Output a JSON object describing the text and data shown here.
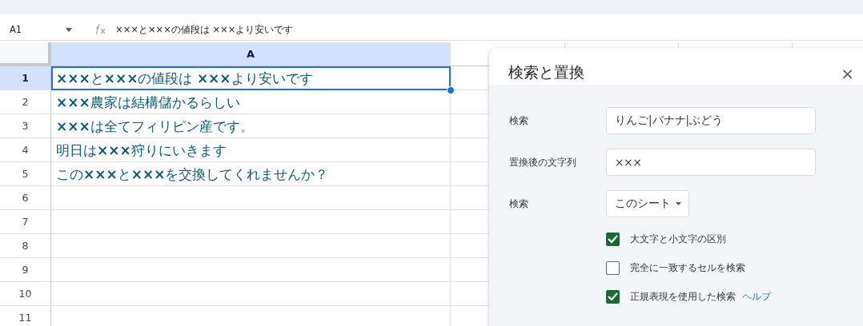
{
  "formula_bar": {
    "cell_ref": "A1",
    "formula": "×××と×××の値段は ×××より安いです"
  },
  "grid": {
    "columns": [
      {
        "label": "A",
        "selected": true
      }
    ],
    "rows": [
      {
        "number": "1",
        "selected": true,
        "cells": [
          "**×××**と**×××**の値段は **×××**より安いです"
        ]
      },
      {
        "number": "2",
        "selected": false,
        "cells": [
          "**×××**農家は結構儲かるらしい"
        ]
      },
      {
        "number": "3",
        "selected": false,
        "cells": [
          "**×××**は全てフィリピン産です。"
        ]
      },
      {
        "number": "4",
        "selected": false,
        "cells": [
          "明日は**×××**狩りにいきます"
        ]
      },
      {
        "number": "5",
        "selected": false,
        "cells": [
          "この**×××**と**×××**を交換してくれませんか？"
        ]
      },
      {
        "number": "6",
        "selected": false
      },
      {
        "number": "7",
        "selected": false
      },
      {
        "number": "8",
        "selected": false
      },
      {
        "number": "9",
        "selected": false
      },
      {
        "number": "10",
        "selected": false
      },
      {
        "number": "11",
        "selected": false
      }
    ]
  },
  "find_replace_dialog": {
    "title": "検索と置換",
    "close": "×",
    "fields": [
      {
        "label": "検索",
        "value": "りんご|バナナ|ぶどう"
      },
      {
        "label": "置換後の文字列",
        "value": "×××"
      }
    ],
    "scope": {
      "label": "検索",
      "value": "このシート"
    },
    "options": [
      {
        "label": "大文字と小文字の区別",
        "checked": true
      },
      {
        "label": "完全に一致するセルを検索",
        "checked": false
      },
      {
        "label": "正規表現を使用した検索",
        "checked": true,
        "link": "ヘルプ"
      }
    ]
  }
}
